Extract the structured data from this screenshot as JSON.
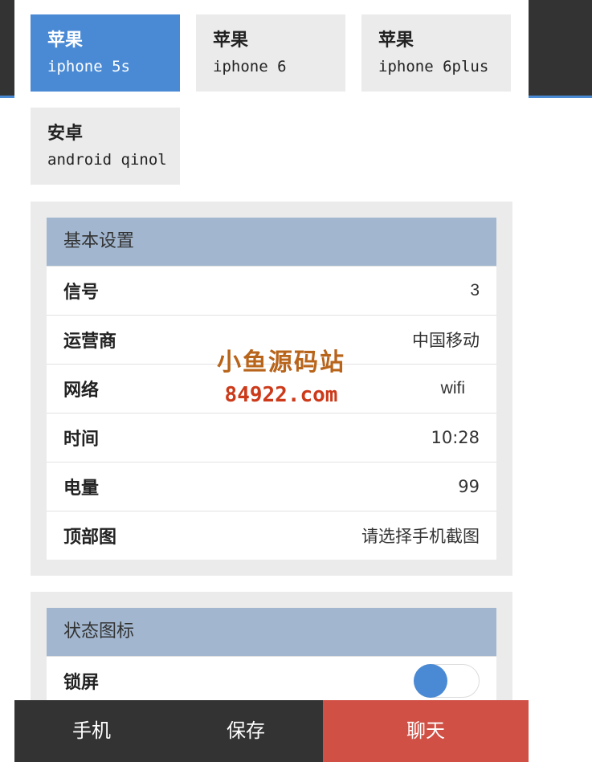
{
  "models": [
    {
      "brand": "苹果",
      "name": "iphone 5s",
      "active": true
    },
    {
      "brand": "苹果",
      "name": "iphone 6",
      "active": false
    },
    {
      "brand": "苹果",
      "name": "iphone 6plus",
      "active": false
    },
    {
      "brand": "安卓",
      "name": "android qinol",
      "active": false
    }
  ],
  "basic_settings": {
    "title": "基本设置",
    "rows": [
      {
        "label": "信号",
        "value": "3"
      },
      {
        "label": "运营商",
        "value": "中国移动"
      },
      {
        "label": "网络",
        "value": "wifi"
      },
      {
        "label": "时间",
        "value": "10:28"
      },
      {
        "label": "电量",
        "value": "99"
      },
      {
        "label": "顶部图",
        "value": "请选择手机截图"
      }
    ]
  },
  "status_icons": {
    "title": "状态图标",
    "rows": [
      {
        "label": "锁屏",
        "toggle_on": true
      }
    ]
  },
  "watermark": {
    "line1": "小鱼源码站",
    "line2": "84922.com"
  },
  "bottom_nav": {
    "phone": "手机",
    "save": "保存",
    "chat": "聊天"
  },
  "colors": {
    "accent": "#4a8ad4",
    "panel_header": "#a2b7cf",
    "chat_button": "#d05045",
    "dark": "#333333"
  }
}
